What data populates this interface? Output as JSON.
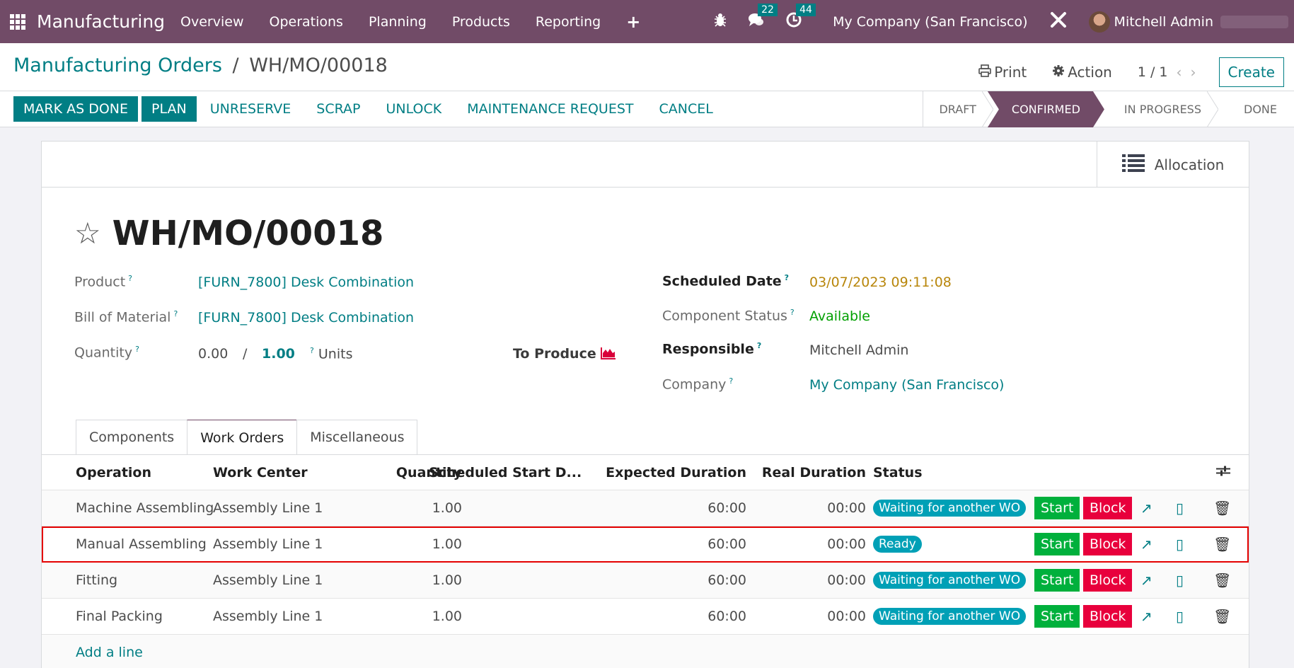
{
  "navbar": {
    "app_name": "Manufacturing",
    "menu": [
      "Overview",
      "Operations",
      "Planning",
      "Products",
      "Reporting"
    ],
    "plus_icon": "+",
    "messages_count": "22",
    "activities_count": "44",
    "company": "My Company (San Francisco)",
    "user": "Mitchell Admin"
  },
  "control_panel": {
    "breadcrumb_parent": "Manufacturing Orders",
    "breadcrumb_sep": "/",
    "breadcrumb_current": "WH/MO/00018",
    "print_label": "Print",
    "action_label": "Action",
    "pager": "1 / 1",
    "create_label": "Create",
    "actions": {
      "mark_as_done": "MARK AS DONE",
      "plan": "PLAN",
      "unreserve": "UNRESERVE",
      "scrap": "SCRAP",
      "unlock": "UNLOCK",
      "maintenance": "MAINTENANCE REQUEST",
      "cancel": "CANCEL"
    },
    "stages": [
      "DRAFT",
      "CONFIRMED",
      "IN PROGRESS",
      "DONE"
    ],
    "active_stage": "CONFIRMED"
  },
  "form": {
    "allocation_label": "Allocation",
    "title": "WH/MO/00018",
    "tooltip_mark": "?",
    "product_label": "Product",
    "product_value": "[FURN_7800] Desk Combination",
    "bom_label": "Bill of Material",
    "bom_value": "[FURN_7800] Desk Combination",
    "quantity_label": "Quantity",
    "quantity_produced": "0.00",
    "quantity_sep": "/",
    "quantity_total": "1.00",
    "quantity_uom": "Units",
    "to_produce_label": "To Produce",
    "scheduled_date_label": "Scheduled Date",
    "scheduled_date_value": "03/07/2023 09:11:08",
    "component_status_label": "Component Status",
    "component_status_value": "Available",
    "responsible_label": "Responsible",
    "responsible_value": "Mitchell Admin",
    "company_label": "Company",
    "company_value": "My Company (San Francisco)",
    "colors": {
      "brand": "#714b67",
      "accent": "#017e84",
      "date": "#b8860b",
      "available": "#00a000",
      "start": "#00b03c",
      "block": "#e8003c",
      "status_badge": "#00a0b6"
    }
  },
  "tabs": [
    {
      "label": "Components",
      "active": false
    },
    {
      "label": "Work Orders",
      "active": true
    },
    {
      "label": "Miscellaneous",
      "active": false
    }
  ],
  "work_orders": {
    "columns": [
      "Operation",
      "Work Center",
      "Quantity",
      "Scheduled Start D...",
      "Expected Duration",
      "Real Duration",
      "Status"
    ],
    "rows": [
      {
        "operation": "Machine Assembling",
        "work_center": "Assembly Line 1",
        "quantity": "1.00",
        "scheduled_start": "",
        "expected_duration": "60:00",
        "real_duration": "00:00",
        "status": "Waiting for another WO",
        "start": "Start",
        "block": "Block"
      },
      {
        "operation": "Manual Assembling",
        "work_center": "Assembly Line 1",
        "quantity": "1.00",
        "scheduled_start": "",
        "expected_duration": "60:00",
        "real_duration": "00:00",
        "status": "Ready",
        "start": "Start",
        "block": "Block"
      },
      {
        "operation": "Fitting",
        "work_center": "Assembly Line 1",
        "quantity": "1.00",
        "scheduled_start": "",
        "expected_duration": "60:00",
        "real_duration": "00:00",
        "status": "Waiting for another WO",
        "start": "Start",
        "block": "Block"
      },
      {
        "operation": "Final Packing",
        "work_center": "Assembly Line 1",
        "quantity": "1.00",
        "scheduled_start": "",
        "expected_duration": "60:00",
        "real_duration": "00:00",
        "status": "Waiting for another WO",
        "start": "Start",
        "block": "Block"
      }
    ],
    "add_line": "Add a line"
  }
}
